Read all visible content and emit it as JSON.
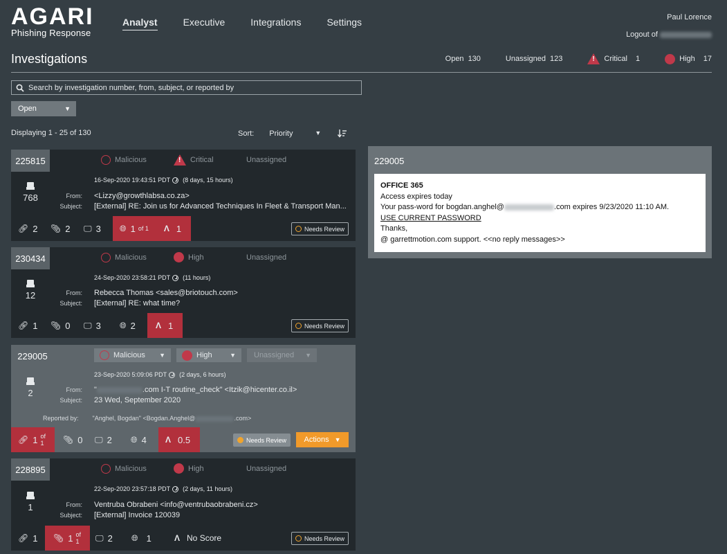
{
  "logo": {
    "main": "AGARI",
    "sub": "Phishing Response"
  },
  "nav": {
    "items": [
      "Analyst",
      "Executive",
      "Integrations",
      "Settings"
    ],
    "active": "Analyst"
  },
  "user": {
    "name": "Paul Lorence",
    "logout": "Logout of"
  },
  "page": {
    "title": "Investigations"
  },
  "stats": {
    "open_label": "Open",
    "open_value": "130",
    "unassigned_label": "Unassigned",
    "unassigned_value": "123",
    "critical_label": "Critical",
    "critical_value": "1",
    "high_label": "High",
    "high_value": "17"
  },
  "search": {
    "placeholder": "Search by investigation number, from, subject, or reported by"
  },
  "filter": {
    "value": "Open"
  },
  "list": {
    "displaying": "Displaying 1 - 25 of 130",
    "sort_label": "Sort:",
    "sort_value": "Priority"
  },
  "labels": {
    "from": "From:",
    "subject": "Subject:",
    "reported_by": "Reported by:",
    "needs_review": "Needs Review",
    "actions": "Actions",
    "of1": "of 1"
  },
  "cards": [
    {
      "id": "225815",
      "verdict": "Malicious",
      "severity": "Critical",
      "assignee": "Unassigned",
      "date": "16-Sep-2020 19:43:51 PDT",
      "age": "(8 days, 15 hours)",
      "inbox_count": "768",
      "from": "<Lizzy@growthlabsa.co.za>",
      "subject": "[External] RE: Join us for Advanced Techniques In Fleet & Transport Man...",
      "links": "2",
      "attachments": "2",
      "hosts": "3",
      "domains": "1",
      "score": "1"
    },
    {
      "id": "230434",
      "verdict": "Malicious",
      "severity": "High",
      "assignee": "Unassigned",
      "date": "24-Sep-2020 23:58:21 PDT",
      "age": "(11 hours)",
      "inbox_count": "12",
      "from": "Rebecca Thomas <sales@briotouch.com>",
      "subject": "[External] RE: what time?",
      "links": "1",
      "attachments": "0",
      "hosts": "3",
      "domains": "2",
      "score": "1"
    },
    {
      "id": "229005",
      "verdict": "Malicious",
      "severity": "High",
      "assignee": "Unassigned",
      "date": "23-Sep-2020 5:09:06 PDT",
      "age": "(2 days, 6 hours)",
      "inbox_count": "2",
      "from_pre": "\"",
      "from_post": ".com I-T routine_check\" <Itzik@hicenter.co.il>",
      "subject": "23 Wed, September 2020",
      "reported_pre": "\"Anghel, Bogdan\" <Bogdan.Anghel@",
      "reported_post": ".com>",
      "links": "1",
      "attachments": "0",
      "hosts": "2",
      "domains": "4",
      "score": "0.5"
    },
    {
      "id": "228895",
      "verdict": "Malicious",
      "severity": "High",
      "assignee": "Unassigned",
      "date": "22-Sep-2020 23:57:18 PDT",
      "age": "(2 days, 11 hours)",
      "inbox_count": "1",
      "from": "Ventruba Obrabeni <info@ventrubaobrabeni.cz>",
      "subject": "[External] Invoice 120039",
      "links": "1",
      "attachments": "1",
      "hosts": "2",
      "domains": "1",
      "score": "No Score"
    }
  ],
  "preview": {
    "id": "229005",
    "heading": "OFFICE 365",
    "line1": "Access expires today",
    "line2_pre": "Your pass-word for bogdan.anghel@",
    "line2_post": ".com expires 9/23/2020 11:10 AM.",
    "link": "USE CURRENT PASSWORD",
    "thanks": "Thanks,",
    "signature": "@ garrettmotion.com support. <<no reply messages>>"
  },
  "colors": {
    "background": "#353e44",
    "card": "#22282c",
    "selected": "#5e666b",
    "alert": "#b2303c",
    "accent": "#f19a2a"
  }
}
